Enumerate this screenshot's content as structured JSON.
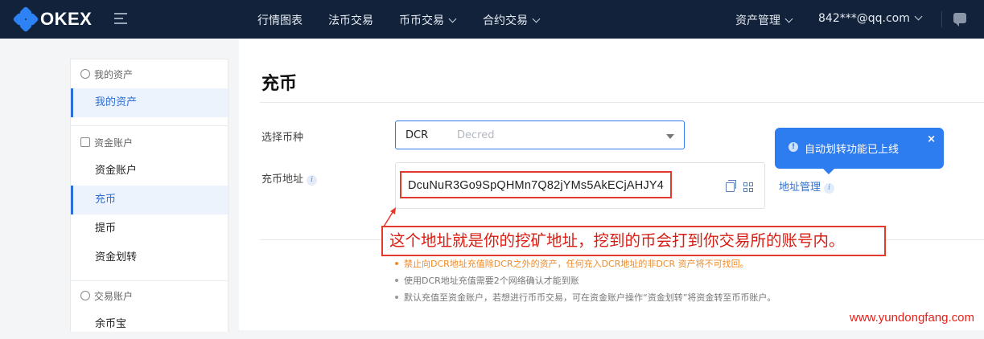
{
  "header": {
    "logo_text": "OKEX",
    "nav": [
      "行情图表",
      "法币交易",
      "币币交易",
      "合约交易"
    ],
    "asset_menu": "资产管理",
    "account": "842***@qq.com"
  },
  "sidebar": {
    "groups": [
      {
        "title": "我的资产",
        "items": [
          "我的资产"
        ]
      },
      {
        "title": "资金账户",
        "items": [
          "资金账户",
          "充币",
          "提币",
          "资金划转"
        ]
      },
      {
        "title": "交易账户",
        "items": [
          "余币宝"
        ]
      }
    ],
    "active_items": [
      "我的资产",
      "充币"
    ]
  },
  "main": {
    "title": "充币",
    "select_label": "选择币种",
    "coin_code": "DCR",
    "coin_name": "Decred",
    "address_label": "充币地址",
    "address": "DcuNuR3Go9SpQHMn7Q82jYMs5AkECjAHJY4",
    "address_manage": "地址管理",
    "tooltip": "自动划转功能已上线",
    "tooltip_close": "×",
    "annotation": "这个地址就是你的挖矿地址，挖到的币会打到你交易所的账号内。",
    "notes": [
      "禁止向DCR地址充值除DCR之外的资产，任何充入DCR地址的非DCR 资产将不可找回。",
      "使用DCR地址充值需要2个网络确认才能到账",
      "默认充值至资金账户，若想进行币币交易，可在资金账户操作“资金划转”将资金转至币币账户。"
    ]
  },
  "watermark": "www.yundongfang.com",
  "colors": {
    "nav_bg": "#11223a",
    "accent": "#2d7cf0",
    "annotation_red": "#e23b2e",
    "warning": "#f08a24"
  }
}
